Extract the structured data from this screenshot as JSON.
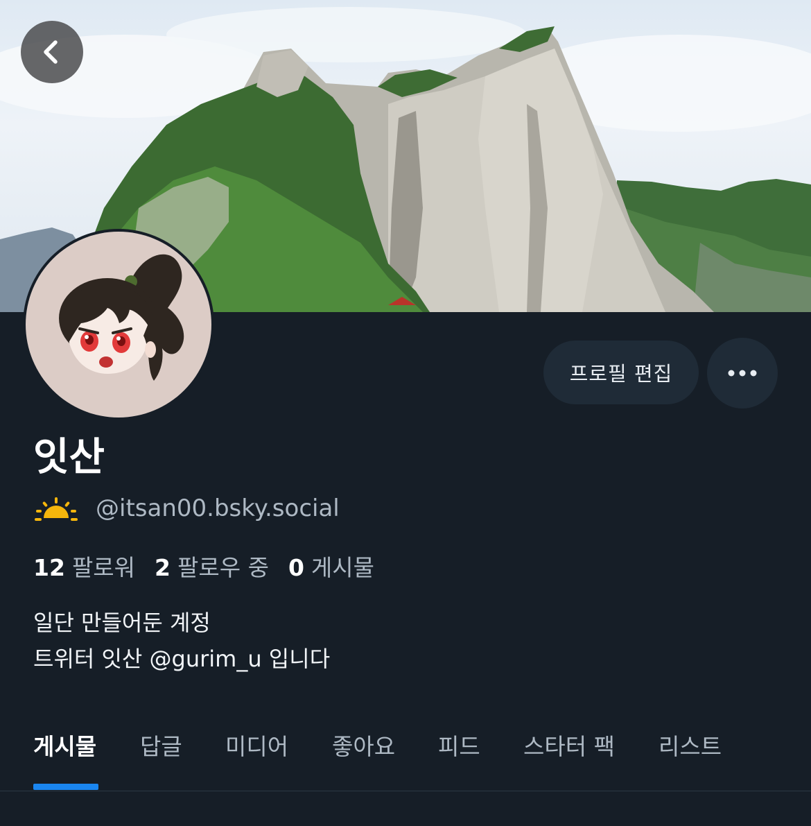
{
  "header": {
    "back_icon": "chevron-left-icon"
  },
  "profile": {
    "display_name": "잇산",
    "handle": "@itsan00.bsky.social",
    "handle_icon": "sunrise-icon",
    "edit_label": "프로필 편집",
    "more_icon": "ellipsis-icon",
    "stats": {
      "followers_count": "12",
      "followers_label": "팔로워",
      "following_count": "2",
      "following_label": "팔로우 중",
      "posts_count": "0",
      "posts_label": "게시물"
    },
    "bio_line1": "일단 만들어둔 계정",
    "bio_line2": "트위터 잇산 @gurim_u 입니다"
  },
  "tabs": [
    {
      "label": "게시물"
    },
    {
      "label": "답글"
    },
    {
      "label": "미디어"
    },
    {
      "label": "좋아요"
    },
    {
      "label": "피드"
    },
    {
      "label": "스타터 팩"
    },
    {
      "label": "리스트"
    }
  ],
  "colors": {
    "background": "#161e27",
    "accent": "#1a86f0",
    "button_bg": "#1f2b37",
    "sun": "#f5b60c"
  }
}
